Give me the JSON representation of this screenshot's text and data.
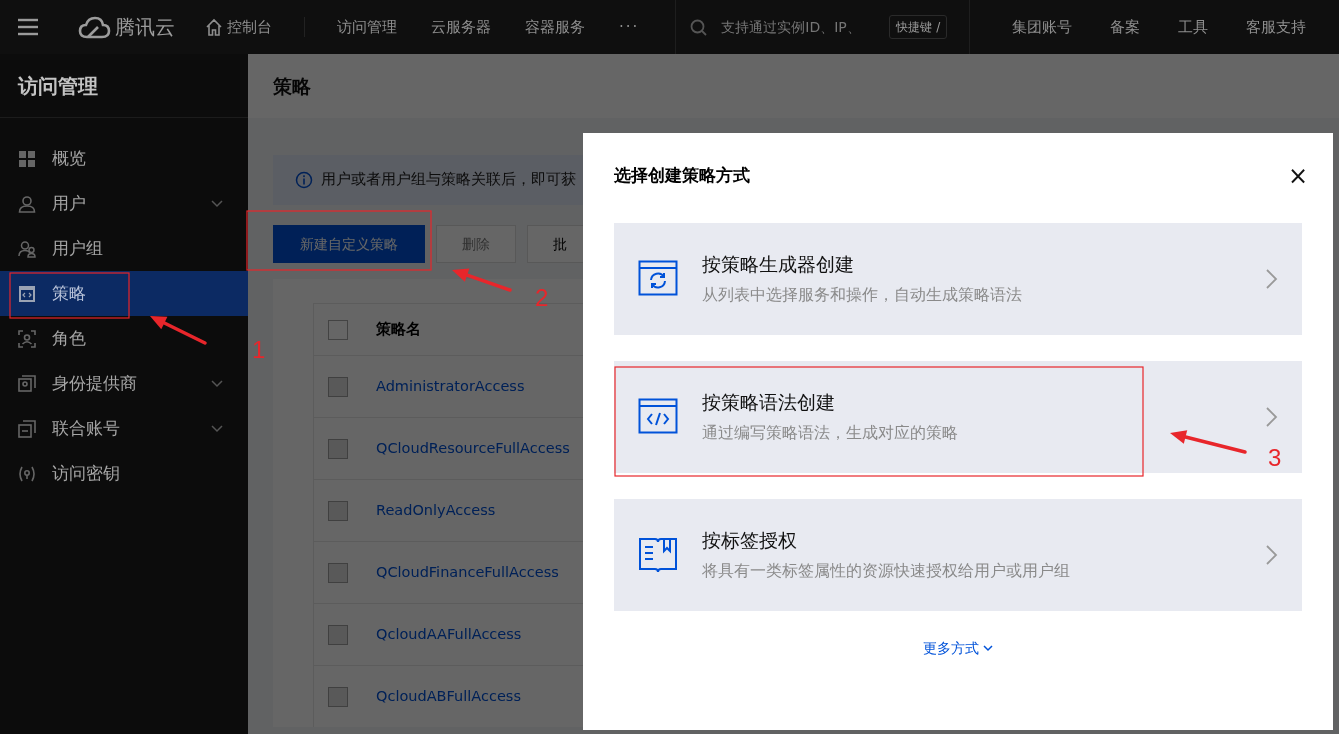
{
  "topbar": {
    "brand": "腾讯云",
    "nav": [
      {
        "label": "控制台",
        "kind": "home"
      },
      {
        "label": "访问管理",
        "kind": "link"
      },
      {
        "label": "云服务器",
        "kind": "link"
      },
      {
        "label": "容器服务",
        "kind": "link"
      },
      {
        "label": "···",
        "kind": "more"
      }
    ],
    "search": {
      "placeholder": "支持通过实例ID、IP、"
    },
    "shortcut": "快捷键 /",
    "links": [
      "集团账号",
      "备案",
      "工具",
      "客服支持"
    ]
  },
  "sidebar": {
    "title": "访问管理",
    "items": [
      {
        "label": "概览",
        "expandable": false,
        "selected": false
      },
      {
        "label": "用户",
        "expandable": true,
        "selected": false
      },
      {
        "label": "用户组",
        "expandable": false,
        "selected": false
      },
      {
        "label": "策略",
        "expandable": false,
        "selected": true
      },
      {
        "label": "角色",
        "expandable": false,
        "selected": false
      },
      {
        "label": "身份提供商",
        "expandable": true,
        "selected": false
      },
      {
        "label": "联合账号",
        "expandable": true,
        "selected": false
      },
      {
        "label": "访问密钥",
        "expandable": false,
        "selected": false
      }
    ]
  },
  "main": {
    "title": "策略",
    "notice": "用户或者用户组与策略关联后，即可获",
    "buttons": [
      {
        "label": "新建自定义策略",
        "kind": "primary",
        "disabled": false
      },
      {
        "label": "删除",
        "kind": "default",
        "disabled": true
      },
      {
        "label": "批",
        "kind": "default",
        "disabled": false
      }
    ],
    "table": {
      "columns": [
        "策略名"
      ],
      "all_checked": false,
      "rows": [
        {
          "name": "AdministratorAccess",
          "checked": false
        },
        {
          "name": "QCloudResourceFullAccess",
          "checked": false
        },
        {
          "name": "ReadOnlyAccess",
          "checked": false
        },
        {
          "name": "QCloudFinanceFullAccess",
          "checked": false
        },
        {
          "name": "QcloudAAFullAccess",
          "checked": false
        },
        {
          "name": "QcloudABFullAccess",
          "checked": false
        }
      ]
    }
  },
  "dialog": {
    "title": "选择创建策略方式",
    "close": "×",
    "options": [
      {
        "title": "按策略生成器创建",
        "description": "从列表中选择服务和操作，自动生成策略语法"
      },
      {
        "title": "按策略语法创建",
        "description": "通过编写策略语法，生成对应的策略"
      },
      {
        "title": "按标签授权",
        "description": "将具有一类标签属性的资源快速授权给用户或用户组"
      }
    ],
    "more": "更多方式"
  },
  "annotations": [
    {
      "label": "1"
    },
    {
      "label": "2"
    },
    {
      "label": "3"
    }
  ]
}
